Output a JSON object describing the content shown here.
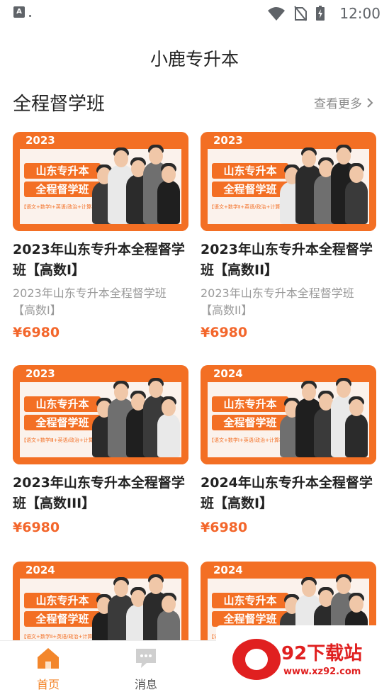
{
  "status_bar": {
    "app_icon": "A",
    "time": "12:00"
  },
  "header": {
    "title": "小鹿专升本"
  },
  "section": {
    "title": "全程督学班",
    "more": "查看更多"
  },
  "cards": [
    {
      "banner_year": "2023",
      "banner_title_1": "山东专升本",
      "banner_title_2": "全程督学班",
      "banner_subjects": "【语文+数学Ⅰ+英语/政治+计算机】",
      "name": "2023年山东专升本全程督学班【高数I】",
      "desc": "2023年山东专升本全程督学班【高数I】",
      "price": "¥6980"
    },
    {
      "banner_year": "2023",
      "banner_title_1": "山东专升本",
      "banner_title_2": "全程督学班",
      "banner_subjects": "【语文+数学Ⅱ+英语/政治+计算机】",
      "name": "2023年山东专升本全程督学班【高数II】",
      "desc": "2023年山东专升本全程督学班【高数II】",
      "price": "¥6980"
    },
    {
      "banner_year": "2023",
      "banner_title_1": "山东专升本",
      "banner_title_2": "全程督学班",
      "banner_subjects": "【语文+数学Ⅲ+英语/政治+计算机】",
      "name": "2023年山东专升本全程督学班【高数III】",
      "desc": "",
      "price": "¥6980"
    },
    {
      "banner_year": "2024",
      "banner_title_1": "山东专升本",
      "banner_title_2": "全程督学班",
      "banner_subjects": "【语文+数学Ⅰ+英语/政治+计算机】",
      "name": "2024年山东专升本全程督学班【高数I】",
      "desc": "",
      "price": "¥6980"
    },
    {
      "banner_year": "2024",
      "banner_title_1": "山东专升本",
      "banner_title_2": "全程督学班",
      "banner_subjects": "【语文+数学Ⅱ+英语/政治+计算机】",
      "name": "",
      "desc": "",
      "price": ""
    },
    {
      "banner_year": "2024",
      "banner_title_1": "山东专升本",
      "banner_title_2": "全程督学班",
      "banner_subjects": "【语文+数学Ⅲ+英语/政治+计算机】",
      "name": "",
      "desc": "",
      "price": ""
    }
  ],
  "bottom_nav": {
    "home": {
      "label": "首页",
      "icon": "home-icon"
    },
    "messages": {
      "label": "消息",
      "icon": "chat-icon"
    }
  },
  "watermark": {
    "title": "92下载站",
    "url": "www.xz92.com"
  },
  "colors": {
    "accent": "#f36f24",
    "price": "#f3662b",
    "nav_active": "#f3862b"
  }
}
